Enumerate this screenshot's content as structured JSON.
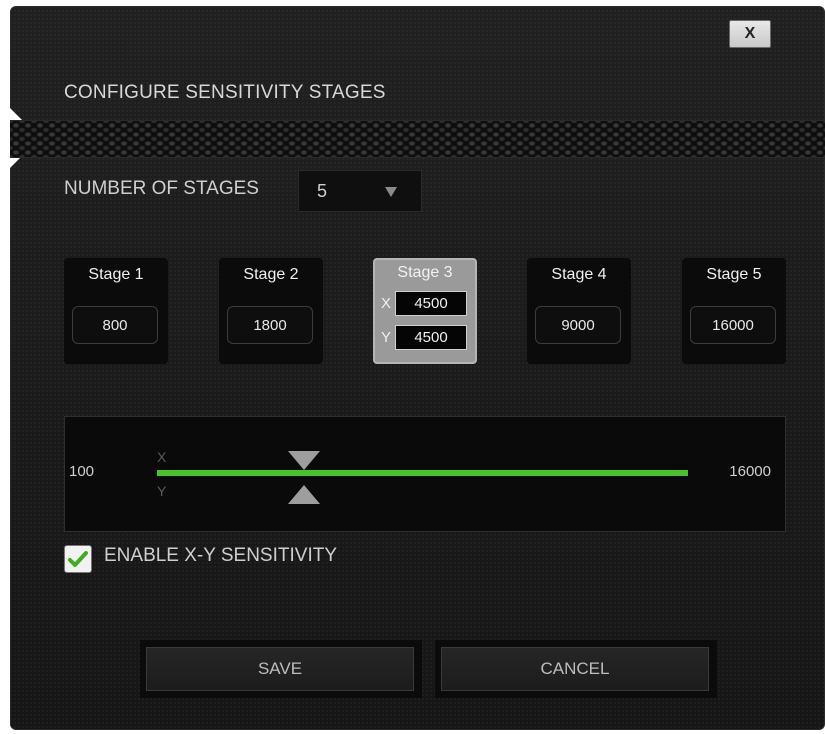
{
  "dialog": {
    "title": "CONFIGURE SENSITIVITY STAGES",
    "close_label": "X"
  },
  "stages_selector": {
    "label": "NUMBER OF STAGES",
    "selected": "5"
  },
  "stages": [
    {
      "label": "Stage 1",
      "value": "800"
    },
    {
      "label": "Stage 2",
      "value": "1800"
    },
    {
      "label": "Stage 3",
      "x_axis": "X",
      "y_axis": "Y",
      "x_value": "4500",
      "y_value": "4500",
      "active": true
    },
    {
      "label": "Stage 4",
      "value": "9000"
    },
    {
      "label": "Stage 5",
      "value": "16000"
    }
  ],
  "slider": {
    "min_label": "100",
    "max_label": "16000",
    "x_axis_label": "X",
    "y_axis_label": "Y",
    "min": 100,
    "max": 16000,
    "x_value": 4500,
    "y_value": 4500,
    "track_color": "#49c12a"
  },
  "xy_sensitivity": {
    "label": "ENABLE X-Y SENSITIVITY",
    "checked": true,
    "check_color": "#3fae1d"
  },
  "buttons": {
    "save_label": "SAVE",
    "cancel_label": "CANCEL"
  }
}
